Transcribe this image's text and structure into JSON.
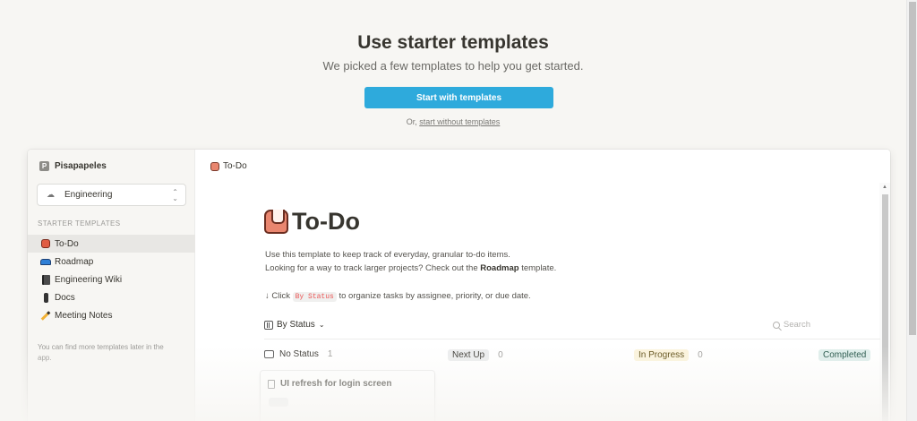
{
  "hero": {
    "title": "Use starter templates",
    "subtitle": "We picked a few templates to help you get started.",
    "start_button": "Start with templates",
    "alt_prefix": "Or, ",
    "alt_link": "start without templates"
  },
  "sidebar": {
    "workspace_initial": "P",
    "workspace_name": "Pisapapeles",
    "team_select": "Engineering",
    "section_label": "STARTER TEMPLATES",
    "items": [
      {
        "label": "To-Do",
        "icon": "todo-icon",
        "active": true
      },
      {
        "label": "Roadmap",
        "icon": "car-icon",
        "active": false
      },
      {
        "label": "Engineering Wiki",
        "icon": "book-icon",
        "active": false
      },
      {
        "label": "Docs",
        "icon": "doc-icon",
        "active": false
      },
      {
        "label": "Meeting Notes",
        "icon": "pencil-icon",
        "active": false
      }
    ],
    "note": "You can find more templates later in the app."
  },
  "main": {
    "breadcrumb": "To-Do",
    "title": "To-Do",
    "desc_line1": "Use this template to keep track of everyday, granular to-do items.",
    "desc_line2_prefix": "Looking for a way to track larger projects? Check out the ",
    "desc_line2_bold": "Roadmap",
    "desc_line2_suffix": " template.",
    "hint_prefix": "↓ Click ",
    "hint_code": "By Status",
    "hint_suffix": " to organize tasks by assignee, priority, or due date.",
    "view_label": "By Status",
    "search_placeholder": "Search",
    "columns": [
      {
        "label": "No Status",
        "count": "1"
      },
      {
        "label": "Next Up",
        "count": "0"
      },
      {
        "label": "In Progress",
        "count": "0"
      },
      {
        "label": "Completed"
      }
    ],
    "card_title": "UI refresh for login screen"
  }
}
